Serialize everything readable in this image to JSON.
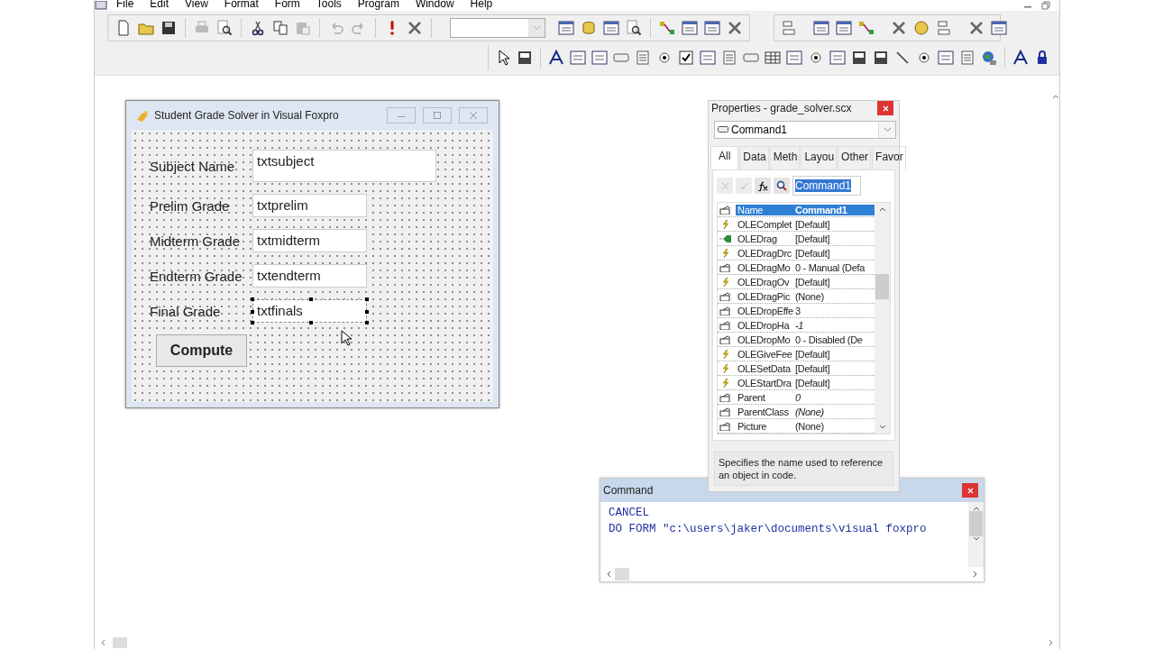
{
  "menu": [
    {
      "label": "File"
    },
    {
      "label": "Edit"
    },
    {
      "label": "View"
    },
    {
      "label": "Format"
    },
    {
      "label": "Form"
    },
    {
      "label": "Tools"
    },
    {
      "label": "Program"
    },
    {
      "label": "Window"
    },
    {
      "label": "Help"
    }
  ],
  "form_window": {
    "title": "Student Grade Solver in Visual Foxpro",
    "fields": [
      {
        "label": "Subject Name",
        "value": "txtsubject",
        "selected": false
      },
      {
        "label": "Prelim Grade",
        "value": "txtprelim",
        "selected": false
      },
      {
        "label": "Midterm Grade",
        "value": "txtmidterm",
        "selected": false
      },
      {
        "label": "Endterm Grade",
        "value": "txtendterm",
        "selected": false
      },
      {
        "label": "Final Grade",
        "value": "txtfinals",
        "selected": true
      }
    ],
    "button": "Compute"
  },
  "properties": {
    "title": "Properties - grade_solver.scx",
    "object": "Command1",
    "tabs": [
      {
        "label": "All",
        "selected": true
      },
      {
        "label": "Data",
        "selected": false
      },
      {
        "label": "Meth",
        "selected": false
      },
      {
        "label": "Layou",
        "selected": false
      },
      {
        "label": "Other",
        "selected": false
      },
      {
        "label": "Favor",
        "selected": false
      }
    ],
    "edit_value": "Command1",
    "rows": [
      {
        "kind": "property",
        "name": "Name",
        "value": "Command1",
        "selected": true,
        "read_only": false
      },
      {
        "kind": "event",
        "name": "OLEComplet",
        "value": "[Default]",
        "selected": false,
        "read_only": false
      },
      {
        "kind": "method",
        "name": "OLEDrag",
        "value": "[Default]",
        "selected": false,
        "read_only": false
      },
      {
        "kind": "event",
        "name": "OLEDragDrc",
        "value": "[Default]",
        "selected": false,
        "read_only": false
      },
      {
        "kind": "property",
        "name": "OLEDragMo",
        "value": "0 - Manual (Defa",
        "selected": false,
        "read_only": false
      },
      {
        "kind": "event",
        "name": "OLEDragOv",
        "value": "[Default]",
        "selected": false,
        "read_only": false
      },
      {
        "kind": "property",
        "name": "OLEDragPic",
        "value": "(None)",
        "selected": false,
        "read_only": false
      },
      {
        "kind": "property",
        "name": "OLEDropEffe",
        "value": "3",
        "selected": false,
        "read_only": false
      },
      {
        "kind": "property",
        "name": "OLEDropHa",
        "value": "-1",
        "selected": false,
        "read_only": true
      },
      {
        "kind": "property",
        "name": "OLEDropMo",
        "value": "0 - Disabled (De",
        "selected": false,
        "read_only": false
      },
      {
        "kind": "event",
        "name": "OLEGiveFee",
        "value": "[Default]",
        "selected": false,
        "read_only": false
      },
      {
        "kind": "event",
        "name": "OLESetData",
        "value": "[Default]",
        "selected": false,
        "read_only": false
      },
      {
        "kind": "event",
        "name": "OLEStartDra",
        "value": "[Default]",
        "selected": false,
        "read_only": false
      },
      {
        "kind": "property",
        "name": "Parent",
        "value": "0",
        "selected": false,
        "read_only": true
      },
      {
        "kind": "property",
        "name": "ParentClass",
        "value": "(None)",
        "selected": false,
        "read_only": true
      },
      {
        "kind": "property",
        "name": "Picture",
        "value": "(None)",
        "selected": false,
        "read_only": false
      }
    ],
    "description": "Specifies the name used to reference an object in code."
  },
  "command_window": {
    "title": "Command",
    "lines": [
      "CANCEL",
      "DO FORM \"c:\\users\\jaker\\documents\\visual foxpro"
    ]
  }
}
